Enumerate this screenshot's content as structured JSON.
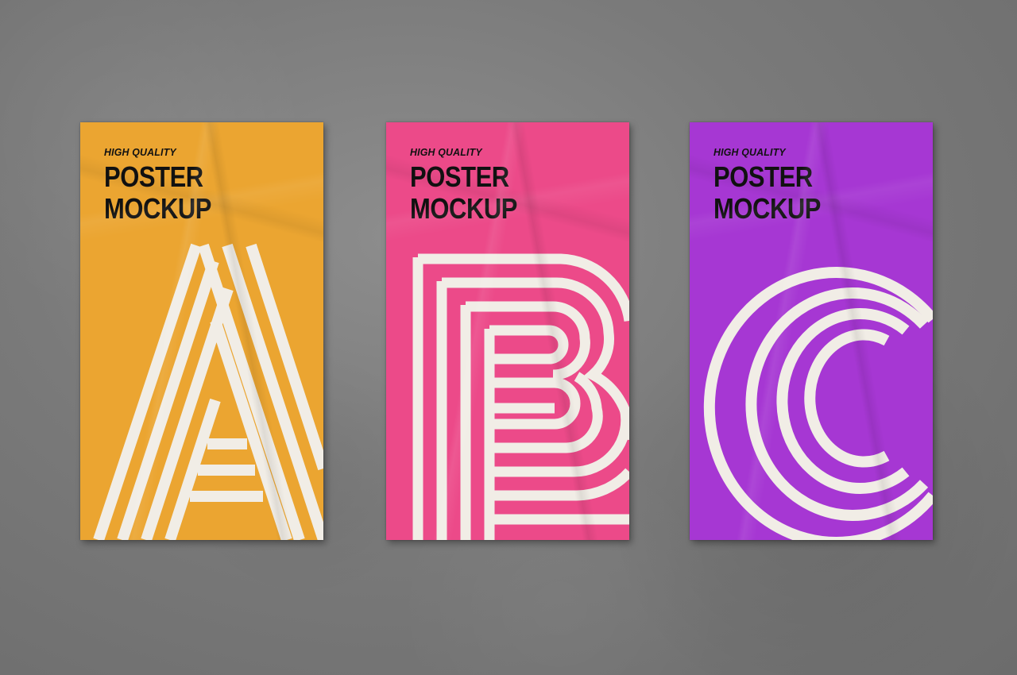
{
  "posters": [
    {
      "id": "a",
      "color": "#eba531",
      "tagline": "HIGH QUALITY",
      "line1": "POSTER",
      "line2": "MOCKUP",
      "letter": "A"
    },
    {
      "id": "b",
      "color": "#ec4a89",
      "tagline": "HIGH QUALITY",
      "line1": "POSTER",
      "line2": "MOCKUP",
      "letter": "B"
    },
    {
      "id": "c",
      "color": "#a637d3",
      "tagline": "HIGH QUALITY",
      "line1": "POSTER",
      "line2": "MOCKUP",
      "letter": "C"
    }
  ],
  "stripe_color": "#f1ede6",
  "wall_color": "#7f7f7f"
}
